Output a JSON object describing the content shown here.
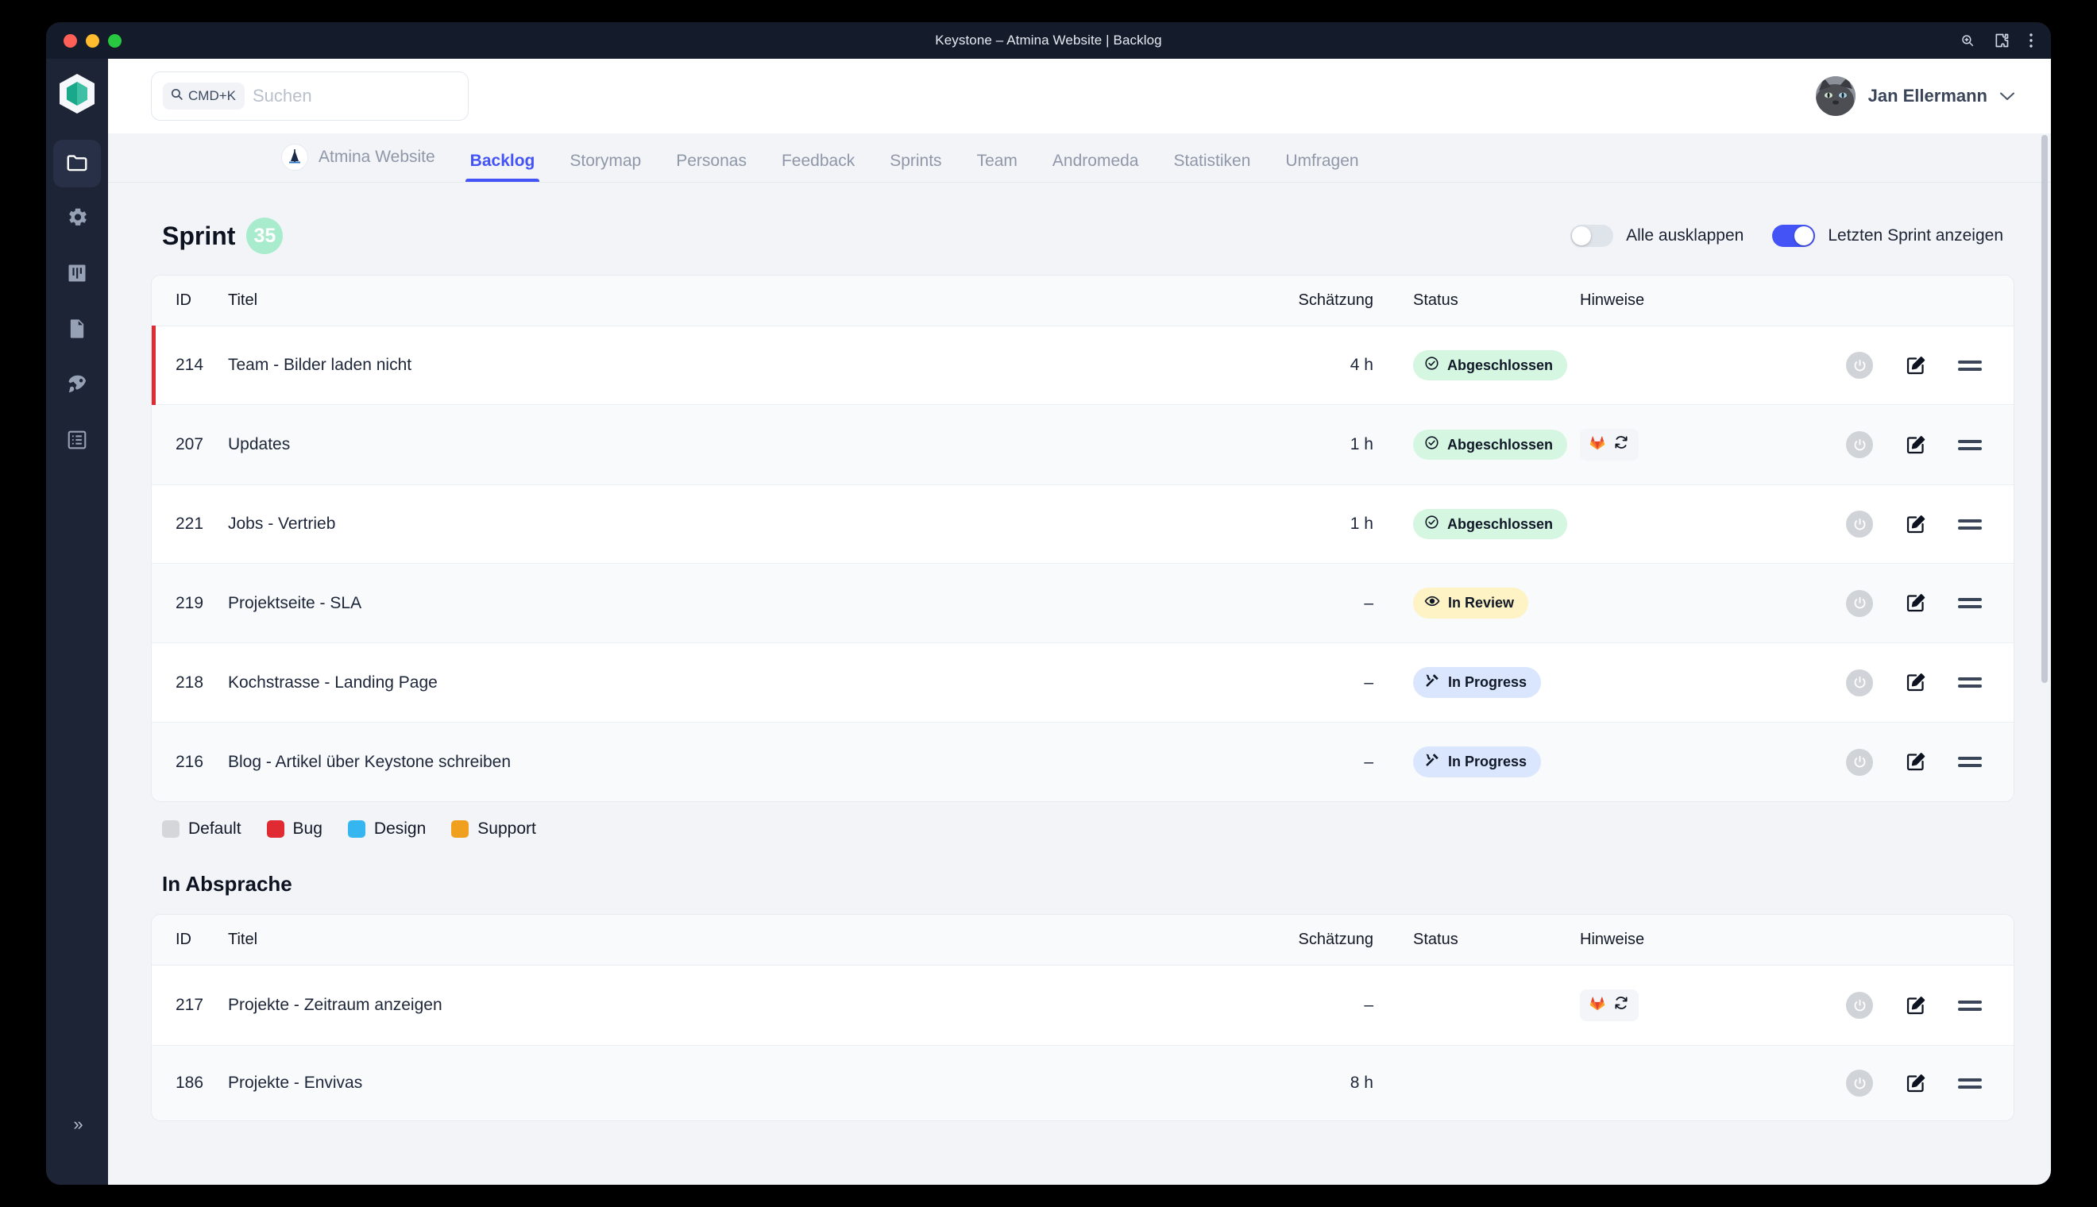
{
  "window": {
    "title": "Keystone – Atmina Website | Backlog",
    "traffic_lights": [
      "close",
      "minimize",
      "zoom"
    ],
    "right_icons": [
      "zoom-icon",
      "extensions-icon",
      "kebab-menu-icon"
    ]
  },
  "rail": {
    "logo": "keystone-logo",
    "items": [
      {
        "icon": "folder-icon",
        "name": "projects",
        "active": true
      },
      {
        "icon": "gear-icon",
        "name": "settings",
        "active": false
      },
      {
        "icon": "kanban-icon",
        "name": "board",
        "active": false
      },
      {
        "icon": "document-icon",
        "name": "documents",
        "active": false
      },
      {
        "icon": "rocket-icon",
        "name": "releases",
        "active": false
      },
      {
        "icon": "list-icon",
        "name": "lists",
        "active": false
      }
    ],
    "expand_label": "»"
  },
  "search": {
    "shortcut": "CMD+K",
    "placeholder": "Suchen",
    "value": ""
  },
  "user": {
    "name": "Jan Ellermann",
    "avatar": "cat-avatar",
    "chevron": "chevron-down-icon"
  },
  "tabs": [
    {
      "label": "Atmina Website",
      "active": false,
      "project": true
    },
    {
      "label": "Backlog",
      "active": true
    },
    {
      "label": "Storymap",
      "active": false
    },
    {
      "label": "Personas",
      "active": false
    },
    {
      "label": "Feedback",
      "active": false
    },
    {
      "label": "Sprints",
      "active": false
    },
    {
      "label": "Team",
      "active": false
    },
    {
      "label": "Andromeda",
      "active": false
    },
    {
      "label": "Statistiken",
      "active": false
    },
    {
      "label": "Umfragen",
      "active": false
    }
  ],
  "sprint_section": {
    "title": "Sprint",
    "badge": "35",
    "badge_color": "#a9eccd",
    "toggles": [
      {
        "label": "Alle ausklappen",
        "on": false
      },
      {
        "label": "Letzten Sprint anzeigen",
        "on": true
      }
    ],
    "columns": [
      "ID",
      "Titel",
      "Schätzung",
      "Status",
      "Hinweise"
    ],
    "rows": [
      {
        "id": "214",
        "title": "Team - Bilder laden nicht",
        "estimate": "4 h",
        "status": "Abgeschlossen",
        "status_kind": "done",
        "hints": [],
        "accent": "#e02b32"
      },
      {
        "id": "207",
        "title": "Updates",
        "estimate": "1 h",
        "status": "Abgeschlossen",
        "status_kind": "done",
        "hints": [
          "gitlab-icon",
          "sync-icon"
        ],
        "accent": ""
      },
      {
        "id": "221",
        "title": "Jobs - Vertrieb",
        "estimate": "1 h",
        "status": "Abgeschlossen",
        "status_kind": "done",
        "hints": [],
        "accent": ""
      },
      {
        "id": "219",
        "title": "Projektseite - SLA",
        "estimate": "–",
        "status": "In Review",
        "status_kind": "review",
        "hints": [],
        "accent": ""
      },
      {
        "id": "218",
        "title": "Kochstrasse - Landing Page",
        "estimate": "–",
        "status": "In Progress",
        "status_kind": "progress",
        "hints": [],
        "accent": ""
      },
      {
        "id": "216",
        "title": "Blog - Artikel über Keystone schreiben",
        "estimate": "–",
        "status": "In Progress",
        "status_kind": "progress",
        "hints": [],
        "accent": ""
      }
    ]
  },
  "legend": [
    {
      "label": "Default",
      "color": "#d4d6da"
    },
    {
      "label": "Bug",
      "color": "#e02b32"
    },
    {
      "label": "Design",
      "color": "#35b6f0"
    },
    {
      "label": "Support",
      "color": "#f0a01e"
    }
  ],
  "absprache_section": {
    "title": "In Absprache",
    "columns": [
      "ID",
      "Titel",
      "Schätzung",
      "Status",
      "Hinweise"
    ],
    "rows": [
      {
        "id": "217",
        "title": "Projekte - Zeitraum anzeigen",
        "estimate": "–",
        "status": "",
        "status_kind": "",
        "hints": [
          "gitlab-icon",
          "sync-icon"
        ],
        "accent": ""
      },
      {
        "id": "186",
        "title": "Projekte - Envivas",
        "estimate": "8 h",
        "status": "",
        "status_kind": "",
        "hints": [],
        "accent": ""
      }
    ]
  },
  "row_actions": [
    "timer-icon",
    "edit-icon",
    "drag-handle-icon"
  ],
  "colors": {
    "accent": "#4353f5",
    "done_bg": "#d5f6e0",
    "review_bg": "#fdf3c5",
    "progress_bg": "#d9e6fd",
    "rail_bg": "#1d2435",
    "titlebar_bg": "#141b2b"
  }
}
